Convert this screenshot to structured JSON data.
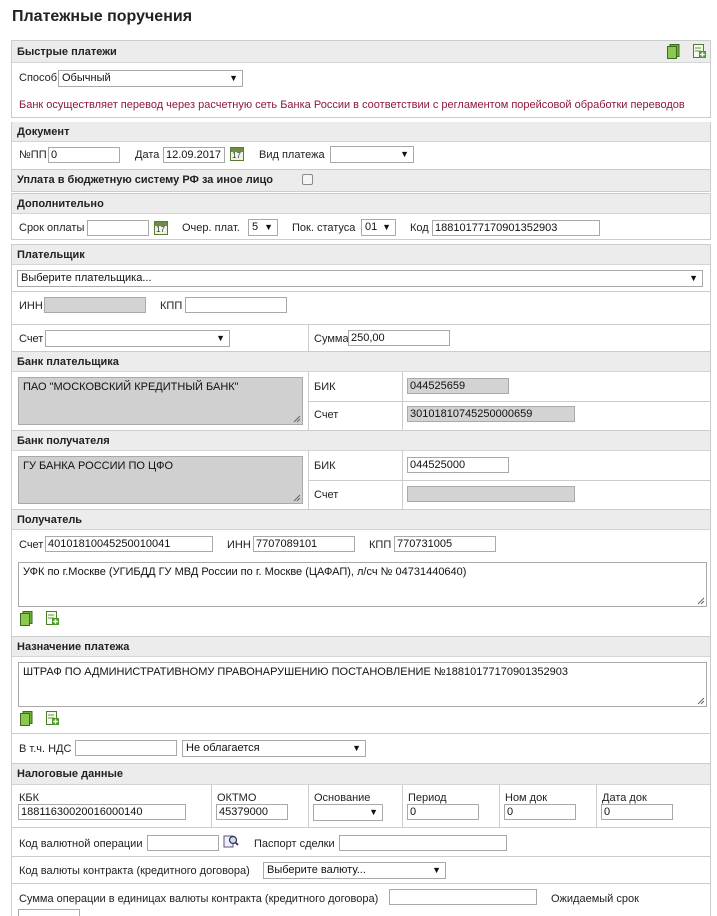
{
  "page_title": "Платежные поручения",
  "quick": {
    "header": "Быстрые платежи",
    "method_label": "Способ",
    "method_value": "Обычный",
    "notice": "Банк осуществляет перевод через расчетную сеть Банка России в соответствии с регламентом порейсовой обработки переводов"
  },
  "document": {
    "header": "Документ",
    "num_label": "№ПП",
    "num_value": "0",
    "date_label": "Дата",
    "date_value": "12.09.2017",
    "type_label": "Вид платежа",
    "type_value": ""
  },
  "budget": {
    "label": "Уплата в бюджетную систему РФ за иное лицо"
  },
  "additional": {
    "header": "Дополнительно",
    "due_label": "Срок оплаты",
    "due_value": "",
    "queue_label": "Очер. плат.",
    "queue_value": "5",
    "status_label": "Пок. статуса",
    "status_value": "01",
    "code_label": "Код",
    "code_value": "18810177170901352903"
  },
  "payer": {
    "header": "Плательщик",
    "select_value": "Выберите плательщика...",
    "inn_label": "ИНН",
    "inn_value": "",
    "kpp_label": "КПП",
    "kpp_value": "",
    "account_label": "Счет",
    "account_value": "",
    "sum_label": "Сумма",
    "sum_value": "250,00"
  },
  "payer_bank": {
    "header": "Банк плательщика",
    "name": "ПАО \"МОСКОВСКИЙ КРЕДИТНЫЙ БАНК\"",
    "bik_label": "БИК",
    "bik_value": "044525659",
    "account_label": "Счет",
    "account_value": "30101810745250000659"
  },
  "payee_bank": {
    "header": "Банк получателя",
    "name": "ГУ БАНКА РОССИИ ПО ЦФО",
    "bik_label": "БИК",
    "bik_value": "044525000",
    "account_label": "Счет",
    "account_value": ""
  },
  "payee": {
    "header": "Получатель",
    "account_label": "Счет",
    "account_value": "40101810045250010041",
    "inn_label": "ИНН",
    "inn_value": "7707089101",
    "kpp_label": "КПП",
    "kpp_value": "770731005",
    "name": "УФК по г.Москве (УГИБДД ГУ МВД России по г. Москве (ЦАФАП), л/сч № 04731440640)"
  },
  "purpose": {
    "header": "Назначение платежа",
    "text": "ШТРАФ ПО АДМИНИСТРАТИВНОМУ ПРАВОНАРУШЕНИЮ ПОСТАНОВЛЕНИЕ №18810177170901352903",
    "vat_label": "В т.ч. НДС",
    "vat_value": "",
    "vat_mode": "Не облагается"
  },
  "tax": {
    "header": "Налоговые данные",
    "kbk_label": "КБК",
    "kbk_value": "18811630020016000140",
    "oktmo_label": "ОКТМО",
    "oktmo_value": "45379000",
    "basis_label": "Основание",
    "basis_value": "",
    "period_label": "Период",
    "period_value": "0",
    "docnum_label": "Ном док",
    "docnum_value": "0",
    "docdate_label": "Дата док",
    "docdate_value": "0"
  },
  "currency": {
    "op_code_label": "Код валютной операции",
    "op_code_value": "",
    "passport_label": "Паспорт сделки",
    "passport_value": "",
    "contract_currency_label": "Код валюты контракта (кредитного договора)",
    "contract_currency_value": "Выберите валюту...",
    "op_sum_label": "Сумма операции в единицах валюты контракта (кредитного договора)",
    "op_sum_value": "",
    "expected_label": "Ожидаемый срок"
  },
  "icons": {
    "copy": "copy-icon",
    "add": "add-icon",
    "calendar": "calendar-icon",
    "lookup": "lookup-icon"
  }
}
